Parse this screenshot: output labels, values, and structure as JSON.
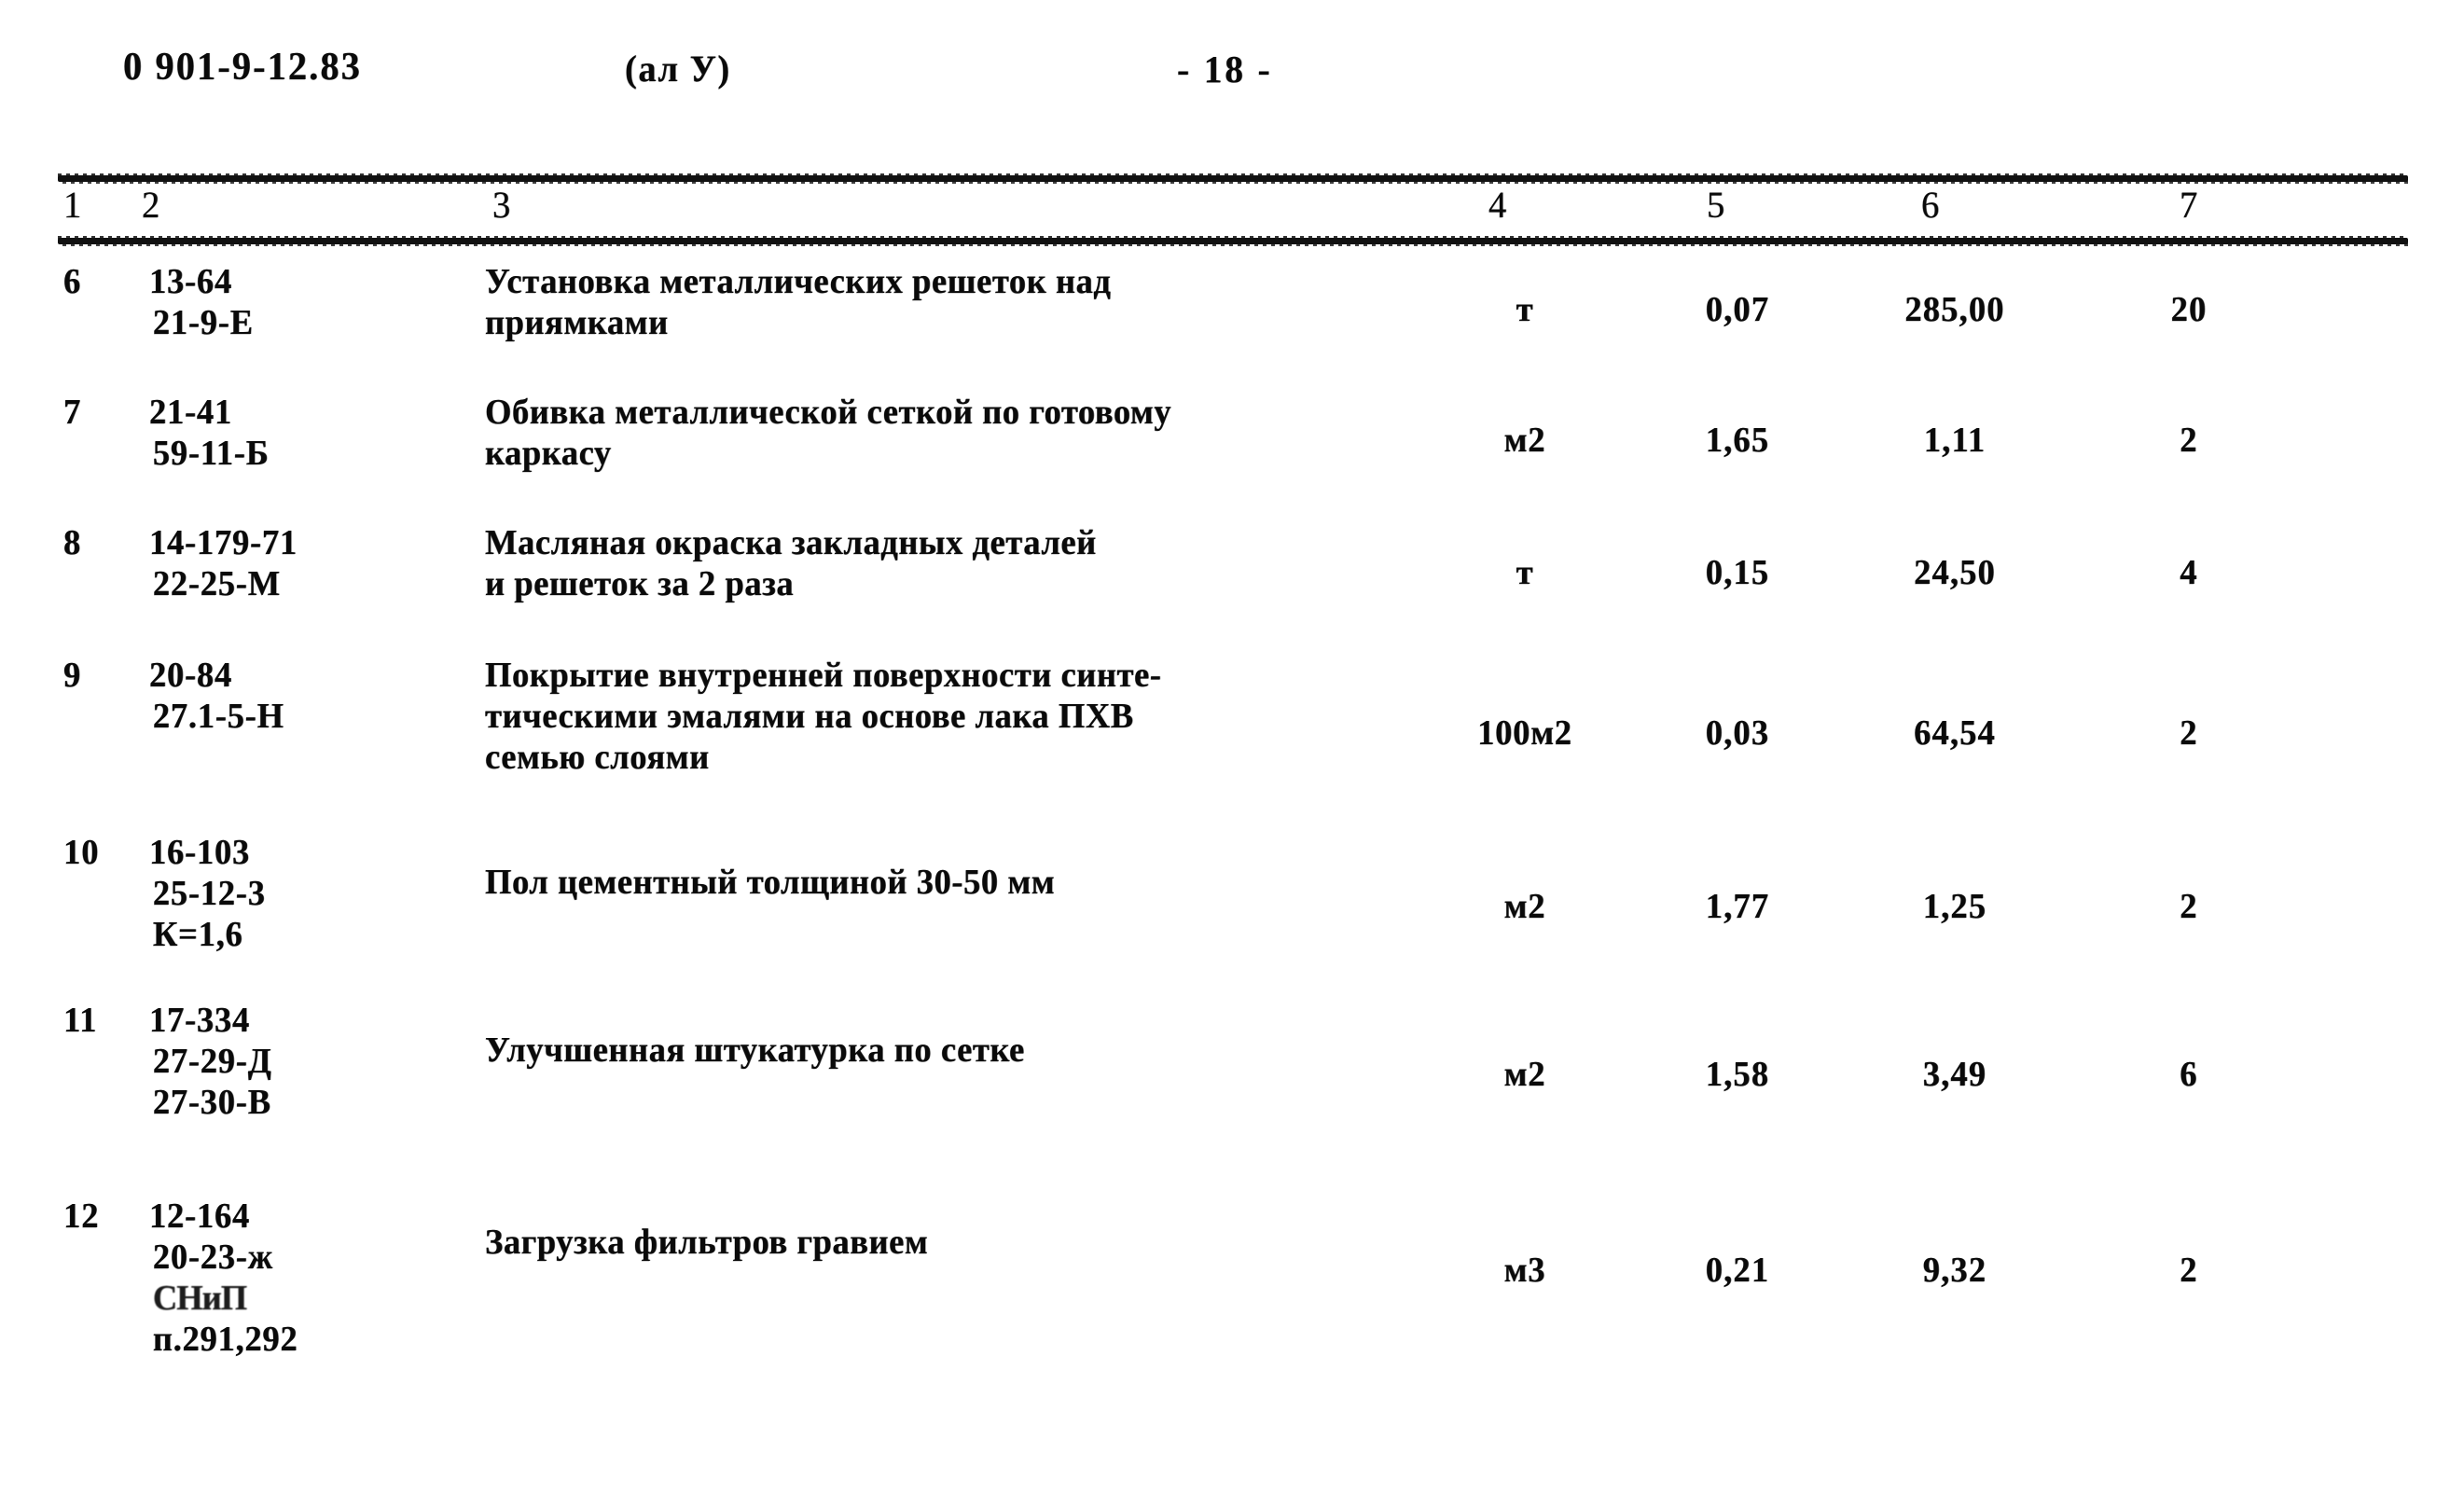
{
  "header": {
    "document_code": "0 901-9-12.83",
    "album": "(ал У)",
    "page_marker": "- 18 -"
  },
  "table": {
    "column_numbers": [
      "1",
      "2",
      "3",
      "4",
      "5",
      "6",
      "7"
    ],
    "rows": [
      {
        "num": "6",
        "codes": [
          "13-64",
          "21-9-Е"
        ],
        "description": [
          "Установка металлических решеток над",
          "приямками"
        ],
        "unit": "т",
        "qty": "0,07",
        "price": "285,00",
        "last": "20"
      },
      {
        "num": "7",
        "codes": [
          "21-41",
          "59-11-Б"
        ],
        "description": [
          "Обивка металлической сеткой по готовому",
          "каркасу"
        ],
        "unit": "м2",
        "qty": "1,65",
        "price": "1,11",
        "last": "2"
      },
      {
        "num": "8",
        "codes": [
          "14-179-71",
          "22-25-М"
        ],
        "description": [
          "Масляная окраска закладных деталей",
          "и решеток за 2 раза"
        ],
        "unit": "т",
        "qty": "0,15",
        "price": "24,50",
        "last": "4"
      },
      {
        "num": "9",
        "codes": [
          "20-84",
          "27.1-5-Н"
        ],
        "description": [
          "Покрытие внутренней поверхности синте-",
          "тическими эмалями на основе лака ПХВ",
          "семью слоями"
        ],
        "unit": "100м2",
        "qty": "0,03",
        "price": "64,54",
        "last": "2"
      },
      {
        "num": "10",
        "codes": [
          "16-103",
          "25-12-3",
          "К=1,6"
        ],
        "description": [
          "Пол цементный толщиной 30-50 мм"
        ],
        "unit": "м2",
        "qty": "1,77",
        "price": "1,25",
        "last": "2"
      },
      {
        "num": "11",
        "codes": [
          "17-334",
          "27-29-Д",
          "27-30-В"
        ],
        "description": [
          "Улучшенная штукатурка по сетке"
        ],
        "unit": "м2",
        "qty": "1,58",
        "price": "3,49",
        "last": "6"
      },
      {
        "num": "12",
        "codes": [
          "12-164",
          "20-23-ж",
          "СНиП",
          "п.291,292"
        ],
        "description": [
          "Загрузка фильтров гравием"
        ],
        "unit": "м3",
        "qty": "0,21",
        "price": "9,32",
        "last": "2"
      }
    ]
  }
}
